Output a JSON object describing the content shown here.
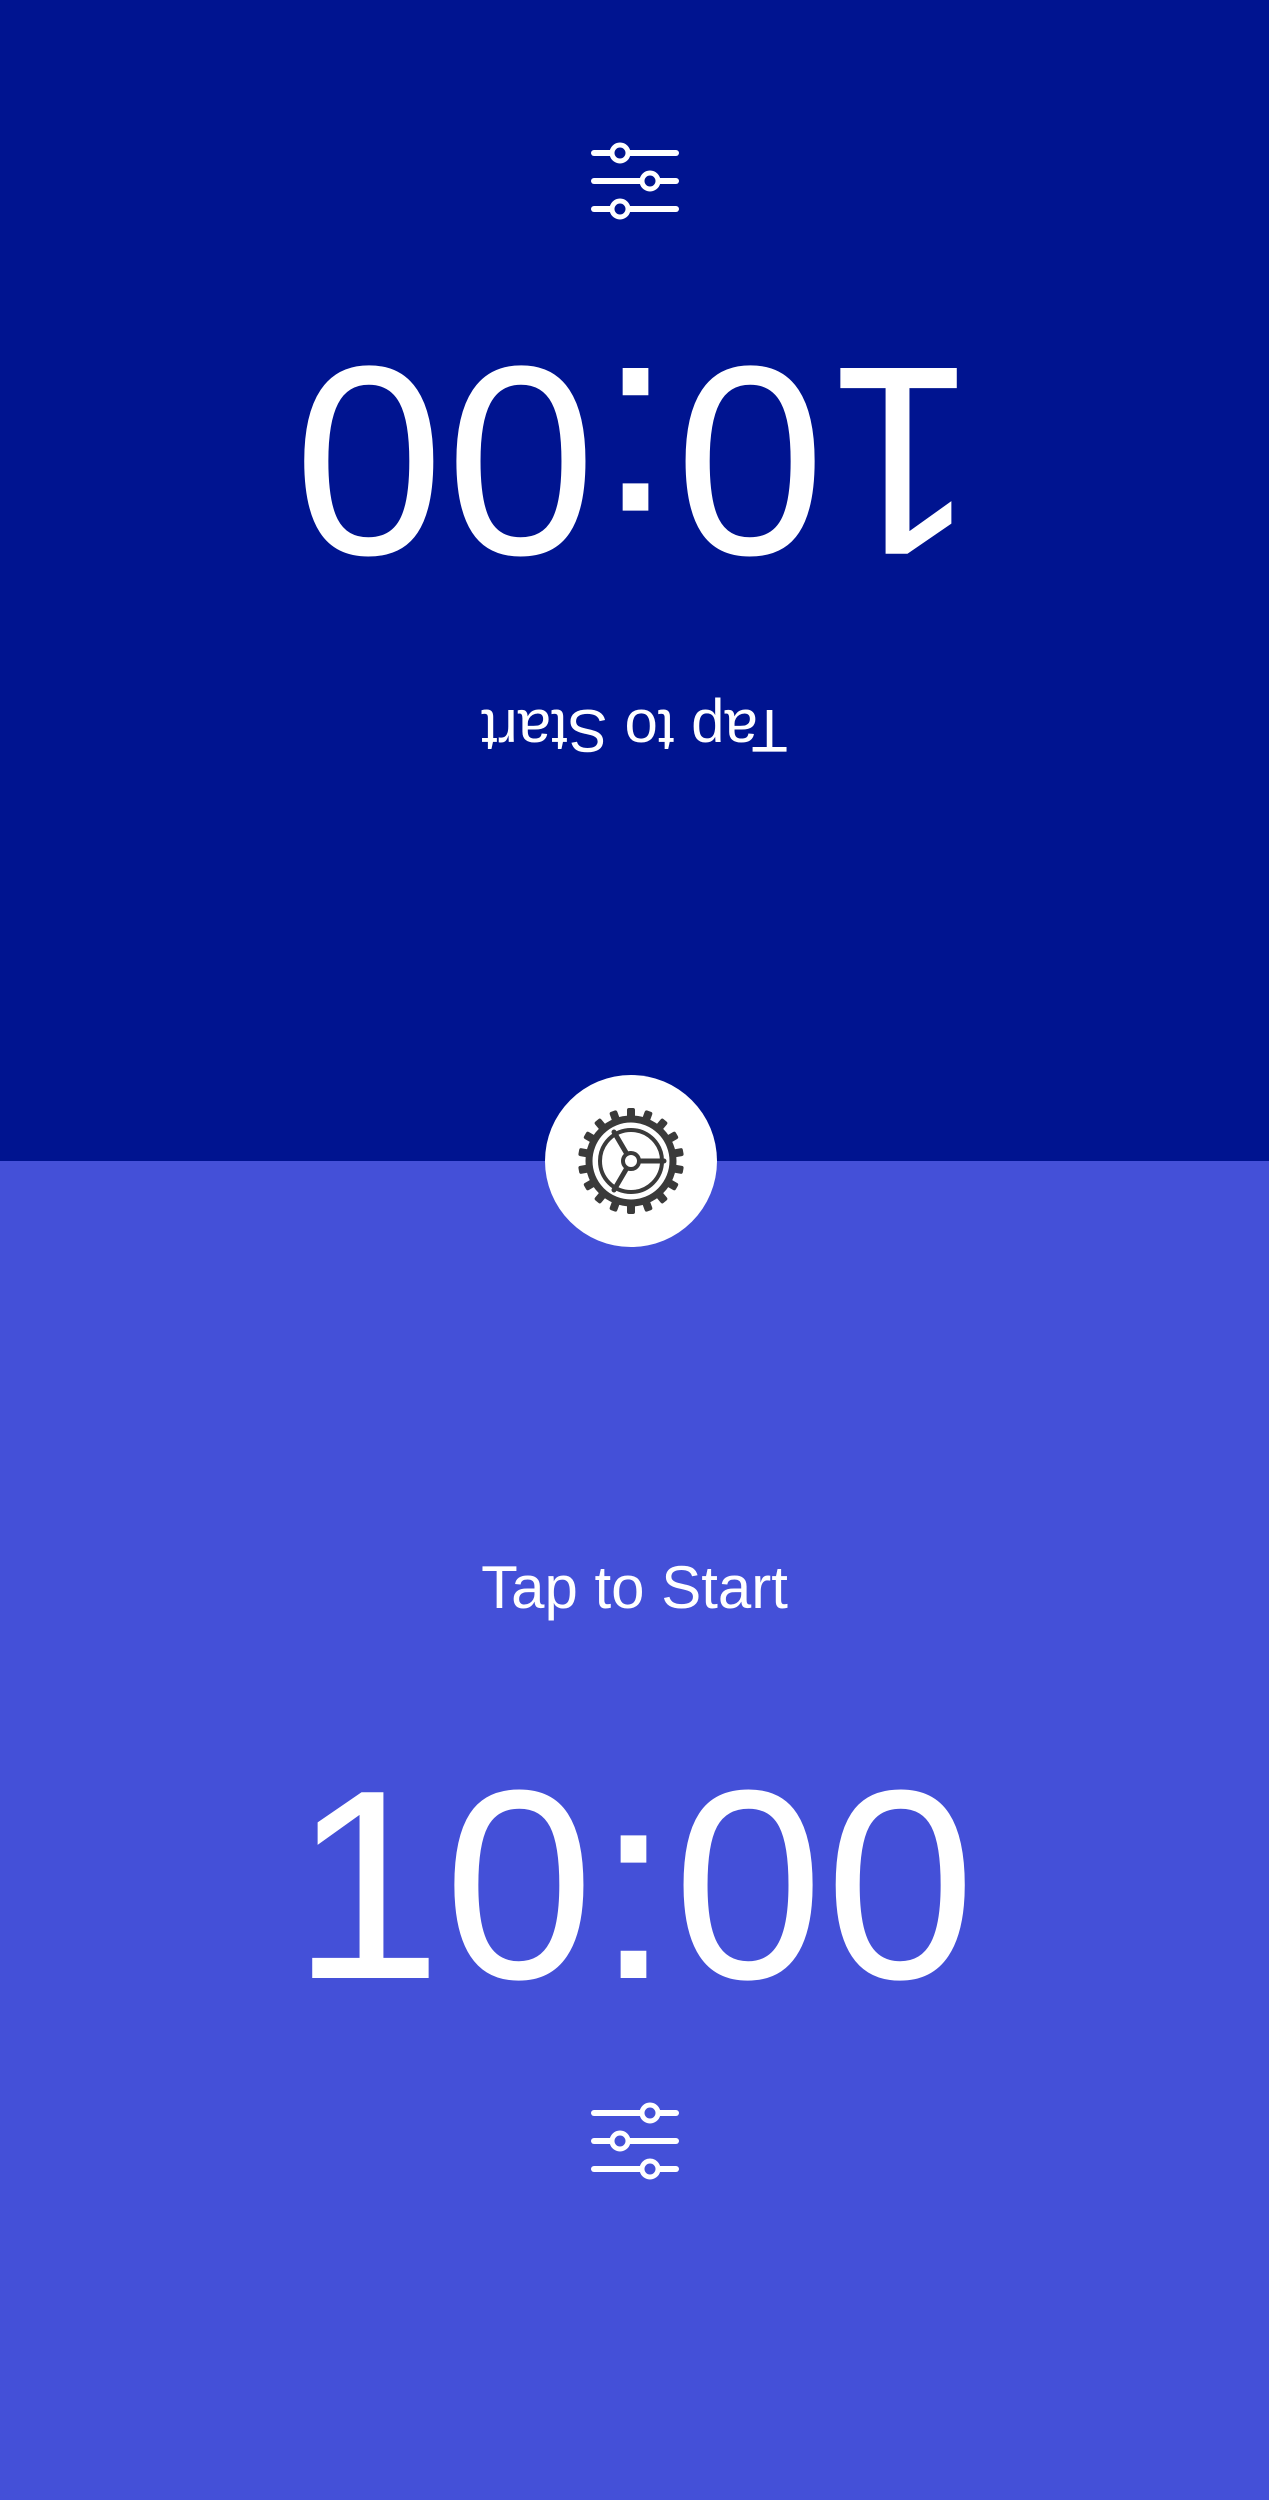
{
  "top_player": {
    "time": "10:00",
    "hint": "Tap to Start",
    "adjust_icon": "sliders-icon",
    "background": "#001490"
  },
  "bottom_player": {
    "time": "10:00",
    "hint": "Tap to Start",
    "adjust_icon": "sliders-icon",
    "background": "#4450d8"
  },
  "settings_button": {
    "icon": "gear-icon",
    "icon_color": "#3a3a3a",
    "background": "#ffffff"
  }
}
